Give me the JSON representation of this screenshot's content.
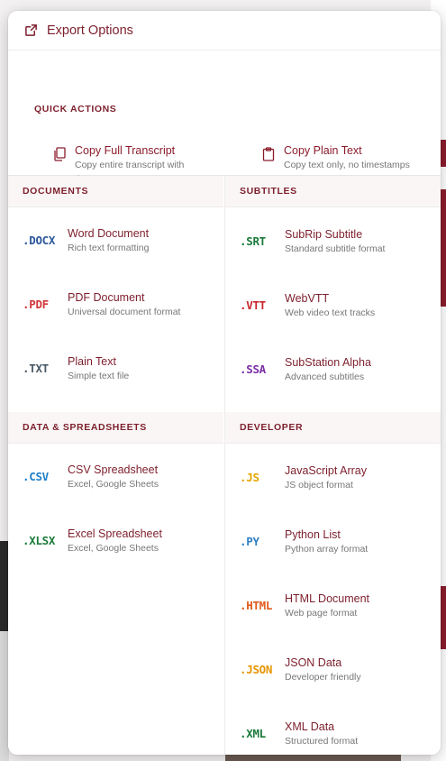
{
  "header": {
    "title": "Export Options",
    "icon": "share-export-icon"
  },
  "quick_actions": {
    "label": "QUICK ACTIONS",
    "items": [
      {
        "title": "Copy Full Transcript",
        "desc": "Copy entire transcript with timestamps",
        "icon": "copy-icon"
      },
      {
        "title": "Copy Plain Text",
        "desc": "Copy text only, no timestamps",
        "icon": "clipboard-icon"
      }
    ]
  },
  "documents": {
    "label": "DOCUMENTS",
    "items": [
      {
        "ext": ".DOCX",
        "title": "Word Document",
        "desc": "Rich text formatting",
        "color": "#2b579a"
      },
      {
        "ext": ".PDF",
        "title": "PDF Document",
        "desc": "Universal document format",
        "color": "#d13438"
      },
      {
        "ext": ".TXT",
        "title": "Plain Text",
        "desc": "Simple text file",
        "color": "#4a5a66"
      }
    ]
  },
  "data_spreadsheets": {
    "label": "DATA & SPREADSHEETS",
    "items": [
      {
        "ext": ".CSV",
        "title": "CSV Spreadsheet",
        "desc": "Excel, Google Sheets",
        "color": "#1e7fc9"
      },
      {
        "ext": ".XLSX",
        "title": "Excel Spreadsheet",
        "desc": "Excel, Google Sheets",
        "color": "#1a7a3a"
      }
    ]
  },
  "subtitles": {
    "label": "SUBTITLES",
    "items": [
      {
        "ext": ".SRT",
        "title": "SubRip Subtitle",
        "desc": "Standard subtitle format",
        "color": "#1a7a3a"
      },
      {
        "ext": ".VTT",
        "title": "WebVTT",
        "desc": "Web video text tracks",
        "color": "#c8262b"
      },
      {
        "ext": ".SSA",
        "title": "SubStation Alpha",
        "desc": "Advanced subtitles",
        "color": "#7b2fa5"
      }
    ]
  },
  "developer": {
    "label": "DEVELOPER",
    "items": [
      {
        "ext": ".JS",
        "title": "JavaScript Array",
        "desc": "JS object format",
        "color": "#e6a700"
      },
      {
        "ext": ".PY",
        "title": "Python List",
        "desc": "Python array format",
        "color": "#2f7fc0"
      },
      {
        "ext": ".HTML",
        "title": "HTML Document",
        "desc": "Web page format",
        "color": "#e15a1c"
      },
      {
        "ext": ".JSON",
        "title": "JSON Data",
        "desc": "Developer friendly",
        "color": "#e69500"
      },
      {
        "ext": ".XML",
        "title": "XML Data",
        "desc": "Structured format",
        "color": "#1a7a3a"
      }
    ]
  }
}
